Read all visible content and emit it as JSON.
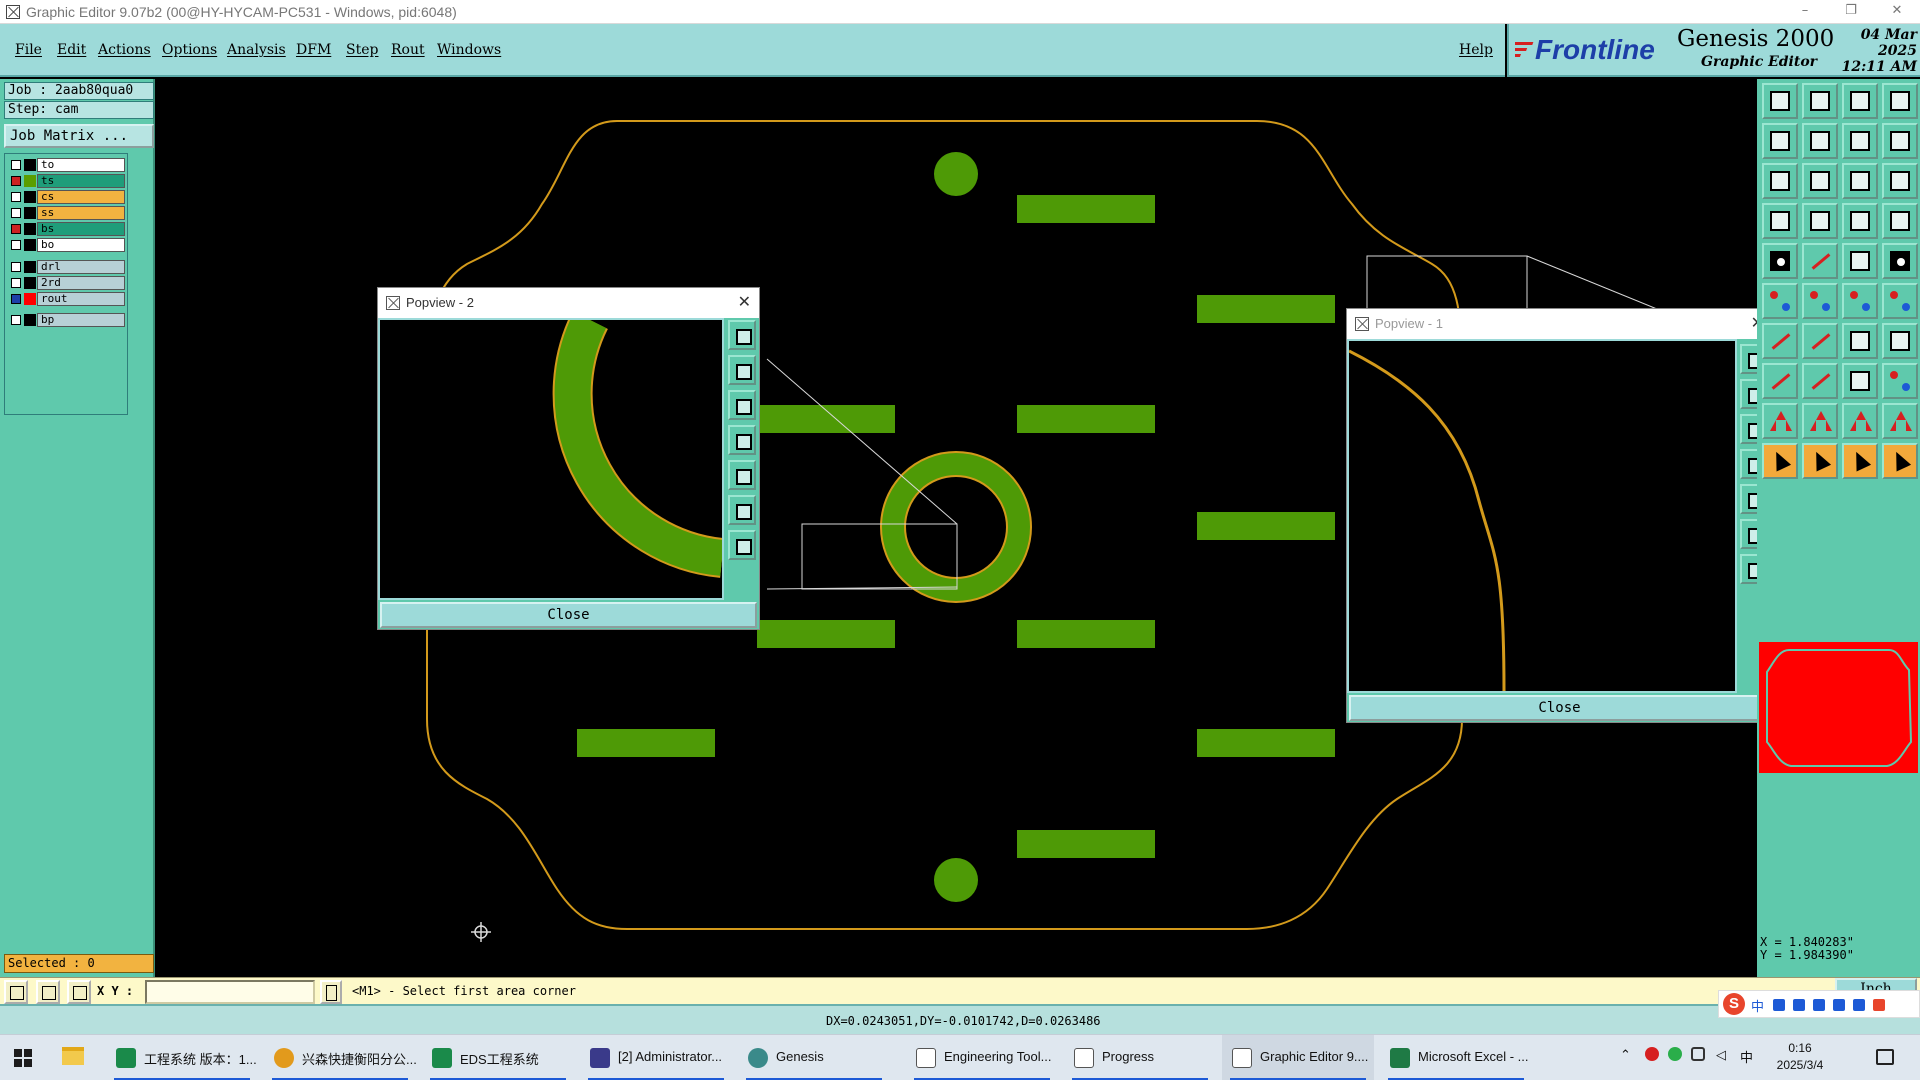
{
  "window": {
    "title": "Graphic Editor 9.07b2 (00@HY-HYCAM-PC531 - Windows, pid:6048)",
    "minimize_glyph": "–",
    "restore_glyph": "❐",
    "close_glyph": "✕"
  },
  "menu": {
    "items": [
      "File",
      "Edit",
      "Actions",
      "Options",
      "Analysis",
      "DFM",
      "Step",
      "Rout",
      "Windows"
    ],
    "help": "Help"
  },
  "brand": {
    "logo": "Frontline",
    "product": "Genesis 2000",
    "subtitle": "Graphic Editor",
    "date": "04 Mar 2025",
    "time": "12:11 AM"
  },
  "left_panel": {
    "job": "Job : 2aab80qua0",
    "step": "Step: cam",
    "job_matrix": "Job Matrix ...",
    "layers": [
      {
        "name": "to",
        "color": "#ffffff",
        "swatch": "#000000",
        "checked": false
      },
      {
        "name": "ts",
        "color": "#1f9d7a",
        "swatch": "#5a9e00",
        "checked": true
      },
      {
        "name": "cs",
        "color": "#f2b340",
        "swatch": "#000000",
        "checked": false
      },
      {
        "name": "ss",
        "color": "#f2b340",
        "swatch": "#000000",
        "checked": false
      },
      {
        "name": "bs",
        "color": "#1f9d7a",
        "swatch": "#000000",
        "checked": true
      },
      {
        "name": "bo",
        "color": "#ffffff",
        "swatch": "#000000",
        "checked": false
      },
      {
        "name": "drl",
        "color": "#b7d0d6",
        "swatch": "#000000",
        "checked": false
      },
      {
        "name": "2rd",
        "color": "#b7d0d6",
        "swatch": "#000000",
        "checked": false
      },
      {
        "name": "rout",
        "color": "#b7d0d6",
        "swatch": "#ff0000",
        "checked": false
      },
      {
        "name": "bp",
        "color": "#b7d0d6",
        "swatch": "#000000",
        "checked": false
      }
    ],
    "selected": "Selected : 0"
  },
  "colors": {
    "pad_green": "#4e9a06",
    "outline_orange": "#d39a1b",
    "panel_teal": "#5fc9ac",
    "menu_cyan": "#9ddad9"
  },
  "popview2": {
    "title": "Popview - 2",
    "close": "Close",
    "close_glyph": "✕"
  },
  "popview1": {
    "title": "Popview - 1",
    "close": "Close",
    "close_glyph": "✕"
  },
  "coords": {
    "x": "X = 1.840283\"",
    "y": "Y = 1.984390\""
  },
  "units_button": "Inch",
  "command": {
    "xy_label": "X Y :",
    "xy_value": "",
    "prompt": "<M1> - Select first area corner"
  },
  "status": {
    "measure": "DX=0.0243051,DY=-0.0101742,D=0.0263486"
  },
  "ime": {
    "logo": "S",
    "lang": "中"
  },
  "taskbar": {
    "apps": [
      {
        "label": "工程系统  版本：1...",
        "icon": "#1a8a4a"
      },
      {
        "label": "兴森快捷衡阳分公...",
        "icon": "#e29a1c"
      },
      {
        "label": "EDS工程系统",
        "icon": "#1a8a4a"
      },
      {
        "label": "[2] Administrator...",
        "icon": "#3a3a8a"
      },
      {
        "label": "Genesis",
        "icon": "#3a8a8a"
      },
      {
        "label": "Engineering Tool...",
        "icon": "#777777"
      },
      {
        "label": "Progress",
        "icon": "#777777"
      },
      {
        "label": "Graphic Editor 9....",
        "icon": "#777777"
      },
      {
        "label": "Microsoft Excel - ...",
        "icon": "#1f7a45"
      }
    ],
    "tray_lang": "中",
    "time": "0:16",
    "date": "2025/3/4"
  }
}
